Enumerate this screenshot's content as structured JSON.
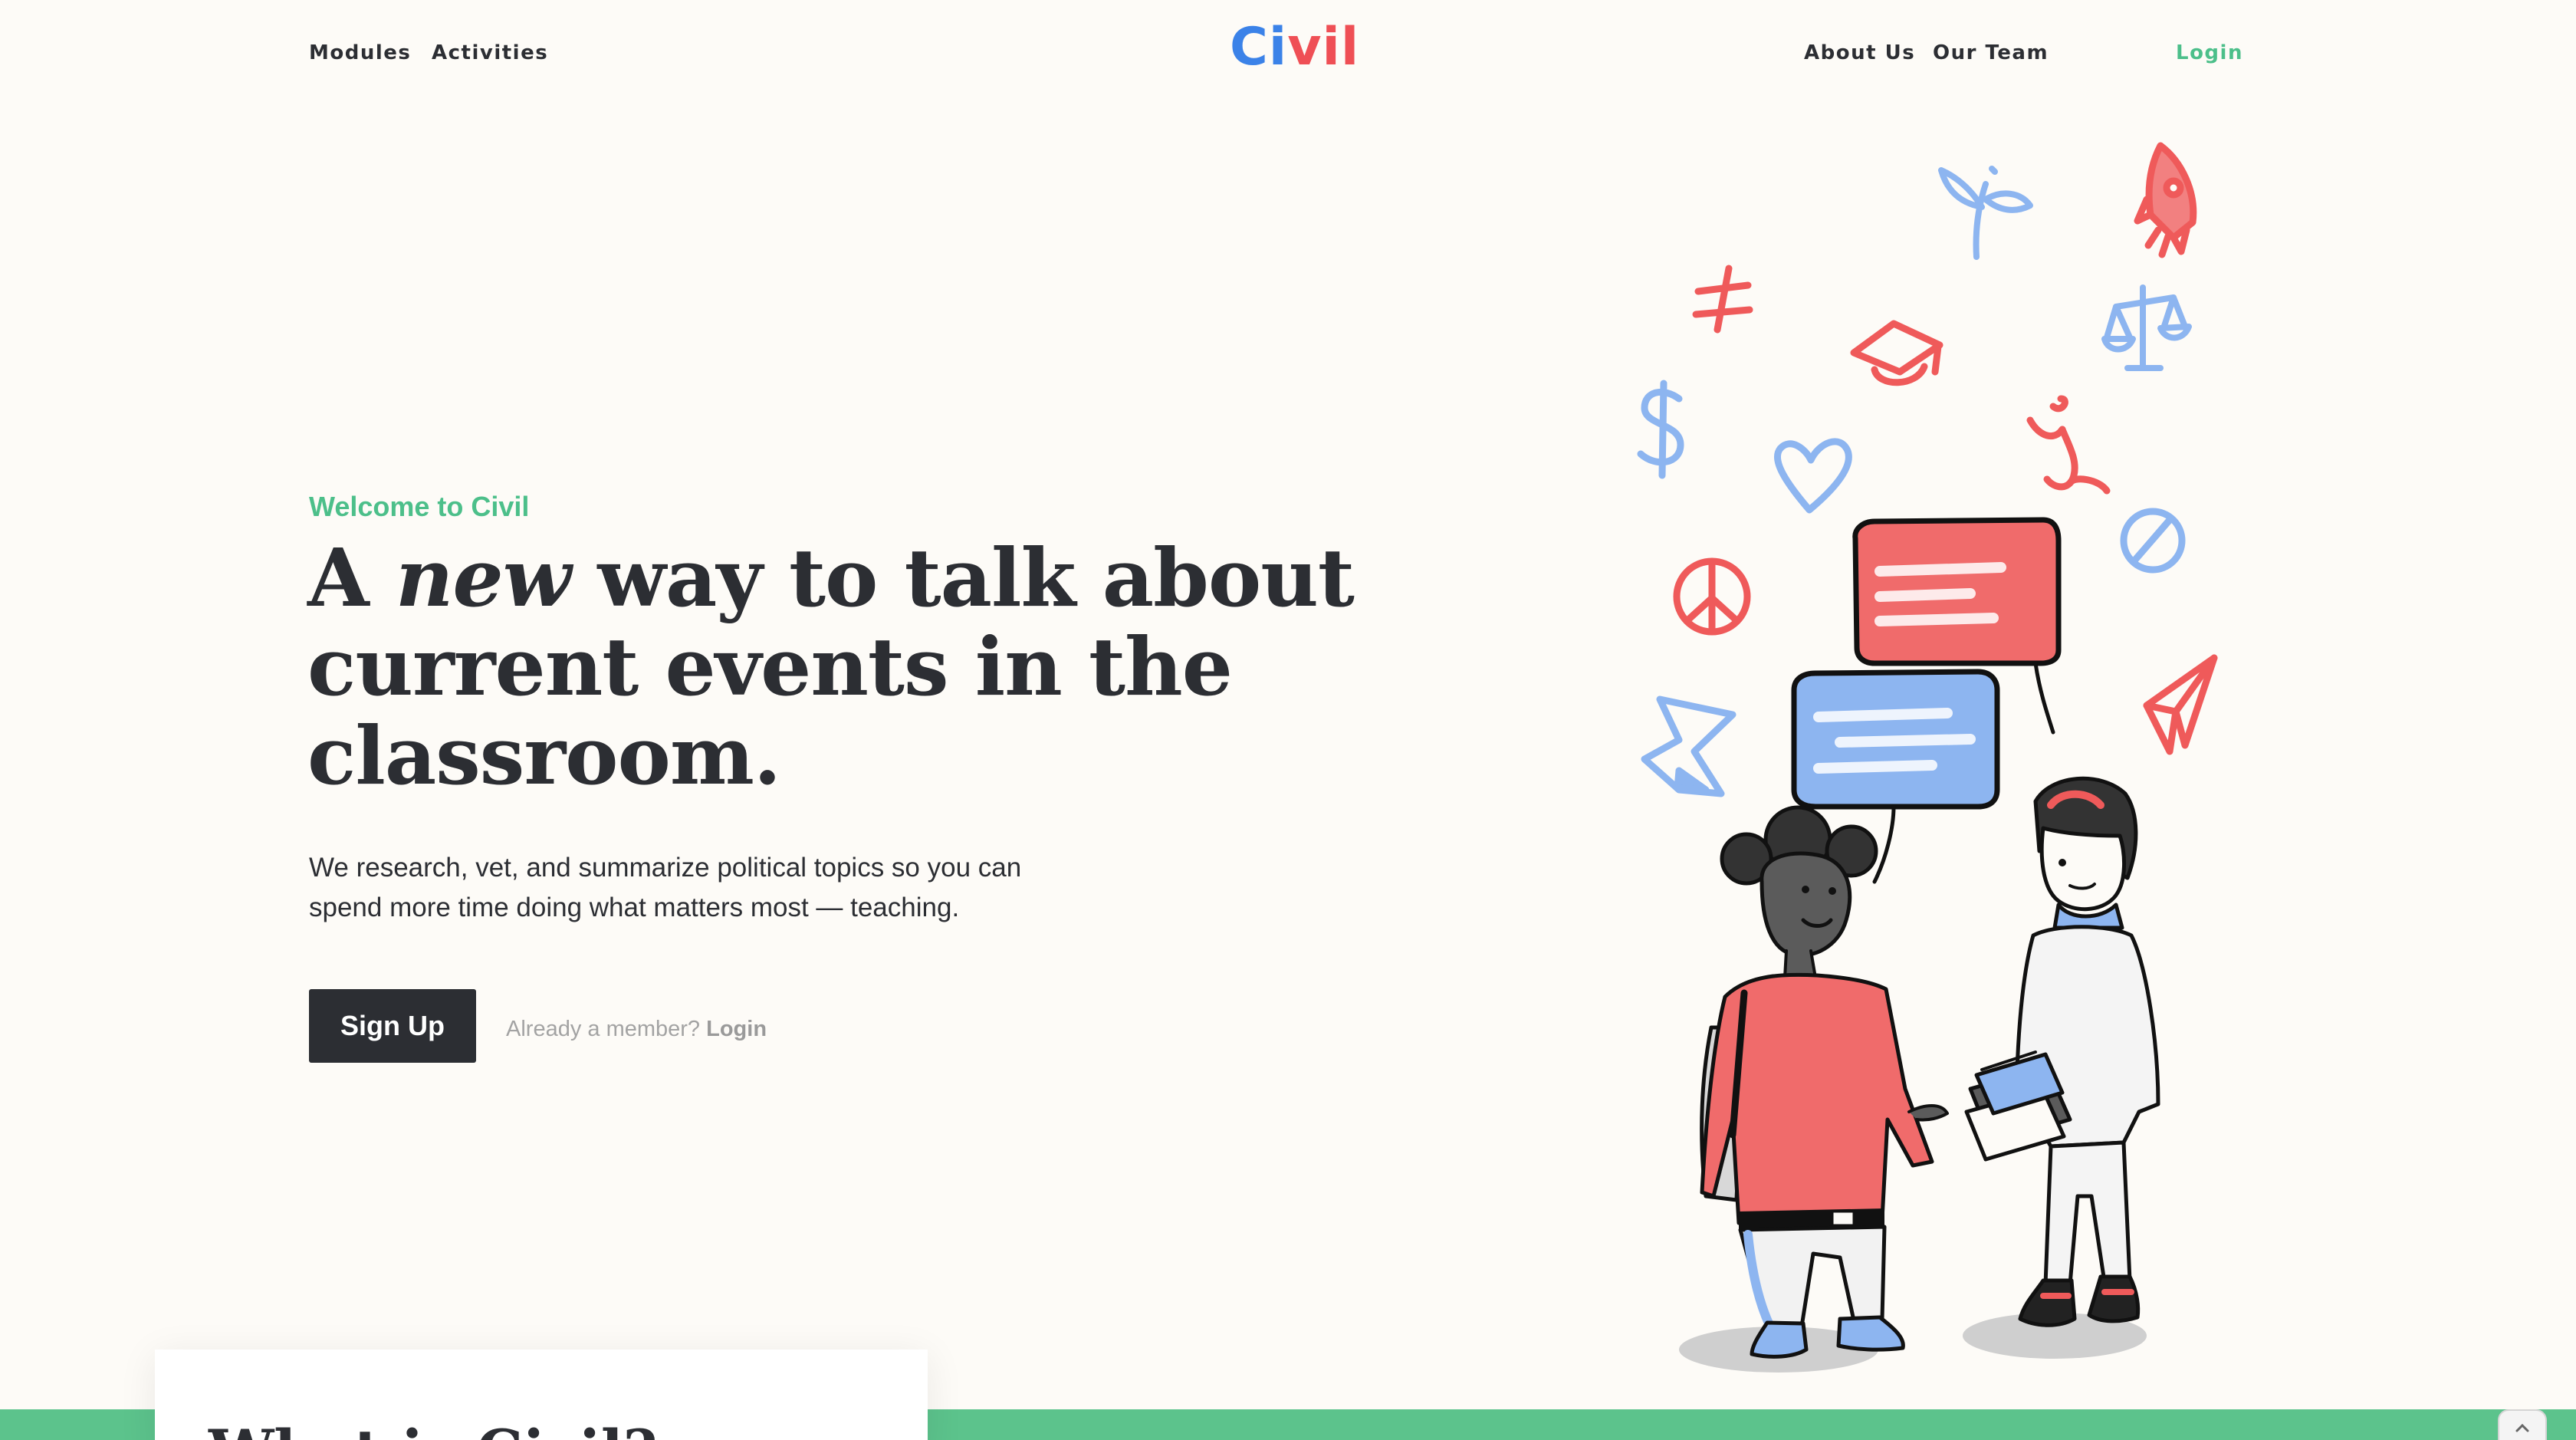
{
  "colors": {
    "background": "#fdfbf7",
    "text_dark": "#2c2e33",
    "accent_green": "#4cbf8a",
    "band_green": "#5cc38c",
    "logo_blue": "#3b82e8",
    "logo_red": "#ef4f55",
    "bubble_red": "#f06b6b",
    "bubble_blue": "#8db5f0"
  },
  "nav": {
    "modules": "Modules",
    "activities": "Activities",
    "logo_part1": "Ci",
    "logo_part2": "vil",
    "about": "About Us",
    "team": "Our Team",
    "login": "Login"
  },
  "hero": {
    "eyebrow": "Welcome to Civil",
    "headline_a": "A ",
    "headline_new": "new",
    "headline_rest1": " way to talk about",
    "headline_line2": "current events in the",
    "headline_line3": "classroom.",
    "subtext_line1": "We research, vet, and summarize political topics so you can",
    "subtext_line2": "spend more time doing what matters most — teaching.",
    "signup": "Sign Up",
    "member_prompt": "Already a member?",
    "member_login": "Login"
  },
  "illustration": {
    "icons": [
      "plant-icon",
      "rocket-icon",
      "not-equal-icon",
      "graduation-cap-icon",
      "scales-icon",
      "dollar-icon",
      "heart-icon",
      "stethoscope-icon",
      "peace-icon",
      "prohibited-icon",
      "hourglass-icon",
      "paper-plane-icon"
    ]
  },
  "section": {
    "what_title": "What is Civil?"
  }
}
